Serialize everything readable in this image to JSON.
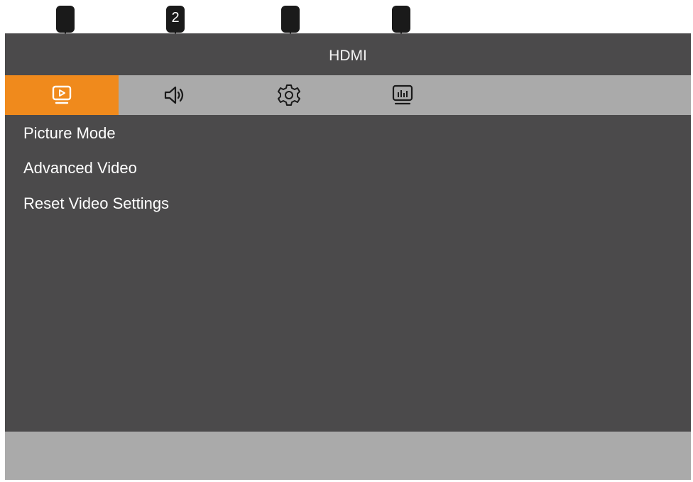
{
  "callouts": [
    {
      "label": ""
    },
    {
      "label": "2"
    },
    {
      "label": ""
    },
    {
      "label": ""
    }
  ],
  "title": "HDMI",
  "tabs": [
    {
      "icon": "picture-icon",
      "active": true
    },
    {
      "icon": "sound-icon",
      "active": false
    },
    {
      "icon": "settings-gear-icon",
      "active": false
    },
    {
      "icon": "info-chart-icon",
      "active": false
    }
  ],
  "menu": {
    "items": [
      {
        "label": "Picture Mode"
      },
      {
        "label": "Advanced Video"
      },
      {
        "label": "Reset Video Settings"
      }
    ]
  },
  "colors": {
    "active_tab": "#f08a1c",
    "tab_bar": "#aaaaaa",
    "panel": "#4b4a4b"
  }
}
